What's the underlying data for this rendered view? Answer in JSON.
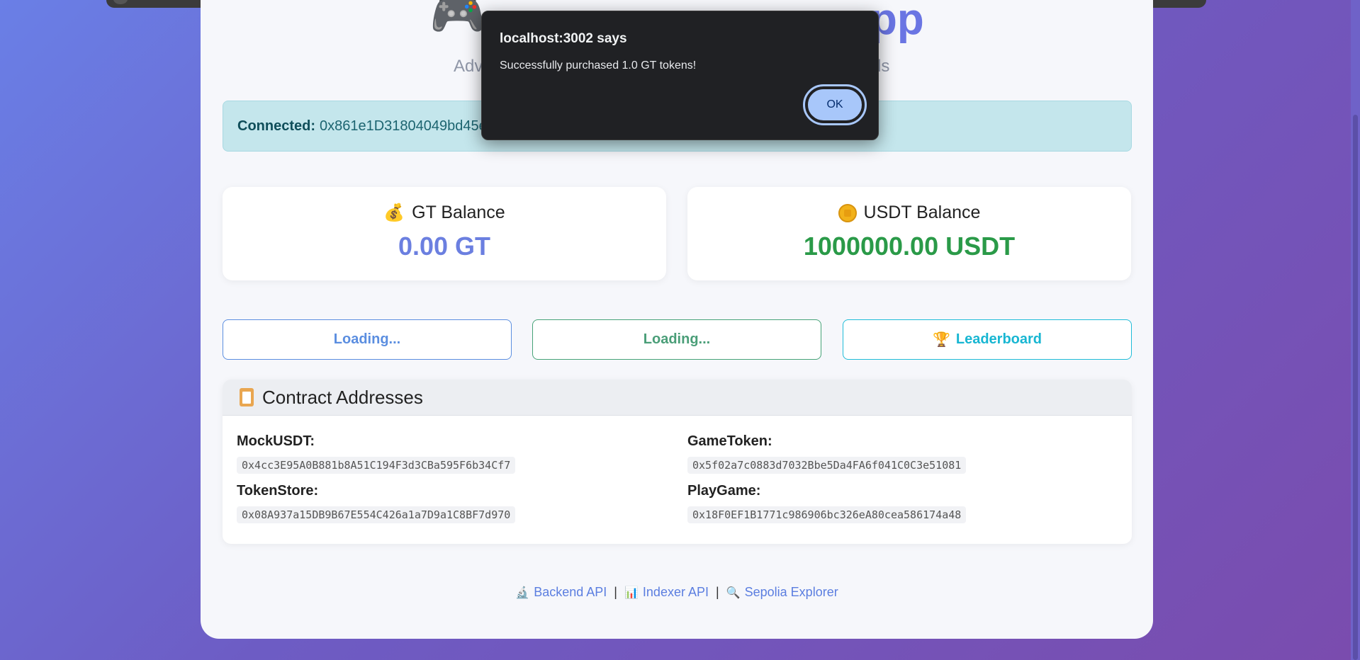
{
  "hero": {
    "title_partial": "pp",
    "subtitle_left": "Adv",
    "subtitle_right": "rds"
  },
  "connected": {
    "label": "Connected:",
    "address": "0x861e1D31804049bd45e/"
  },
  "balances": {
    "gt": {
      "label": "GT Balance",
      "value": "0.00 GT",
      "icon": "money-bag-icon"
    },
    "usdt": {
      "label": "USDT Balance",
      "value": "1000000.00 USDT",
      "icon": "coin-icon"
    }
  },
  "actions": {
    "btn1": "Loading...",
    "btn2": "Loading...",
    "btn3": "Leaderboard"
  },
  "contracts": {
    "title": "Contract Addresses",
    "items": [
      {
        "name": "MockUSDT:",
        "address": "0x4cc3E95A0B881b8A51C194F3d3CBa595F6b34Cf7"
      },
      {
        "name": "GameToken:",
        "address": "0x5f02a7c0883d7032Bbe5Da4FA6f041C0C3e51081"
      },
      {
        "name": "TokenStore:",
        "address": "0x08A937a15DB9B67E554C426a1a7D9a1C8BF7d970"
      },
      {
        "name": "PlayGame:",
        "address": "0x18F0EF1B1771c986906bc326eA80cea586174a48"
      }
    ]
  },
  "footer": {
    "backend": "Backend API",
    "indexer": "Indexer API",
    "explorer": "Sepolia Explorer",
    "separator": "|"
  },
  "dialog": {
    "title": "localhost:3002 says",
    "message": "Successfully purchased 1.0 GT tokens!",
    "ok": "OK"
  },
  "colors": {
    "accent": "#6a75e3",
    "usdt": "#2a9a48",
    "dialog_bg": "#202124",
    "ok_button": "#a8c7fa"
  }
}
